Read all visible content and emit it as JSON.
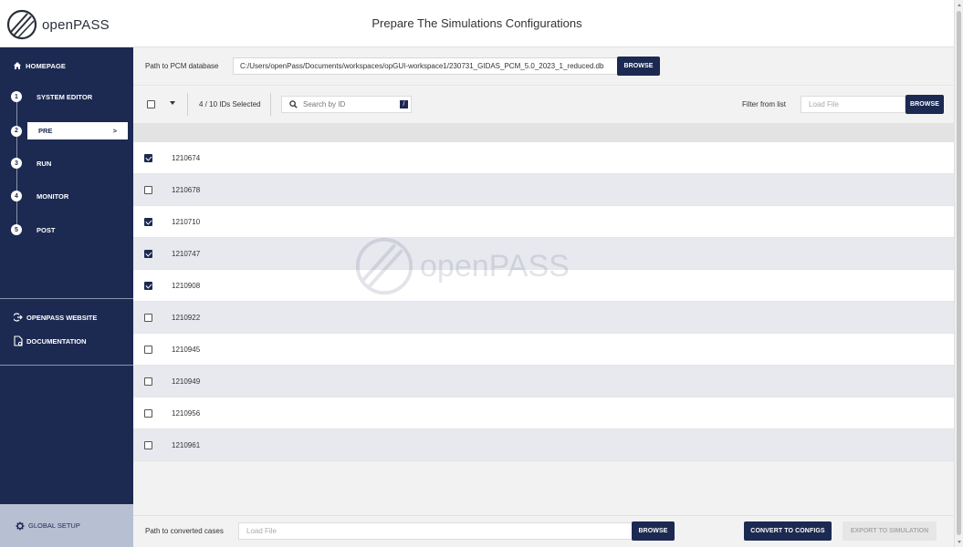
{
  "header": {
    "logo_text": "openPASS",
    "title": "Prepare The Simulations Configurations"
  },
  "sidebar": {
    "home": "HOMEPAGE",
    "steps": [
      {
        "num": "1",
        "label": "SYSTEM EDITOR"
      },
      {
        "num": "2",
        "label": "PRE",
        "chevron": ">"
      },
      {
        "num": "3",
        "label": "RUN"
      },
      {
        "num": "4",
        "label": "MONITOR"
      },
      {
        "num": "5",
        "label": "POST"
      }
    ],
    "links": [
      {
        "label": "OPENPASS WEBSITE"
      },
      {
        "label": "DOCUMENTATION"
      }
    ],
    "global_setup": "GLOBAL SETUP"
  },
  "path_row": {
    "label": "Path to PCM database",
    "value": "C:/Users/openPass/Documents/workspaces/opGUI-workspace1/230731_GIDAS_PCM_5.0_2023_1_reduced.db",
    "browse": "BROWSE"
  },
  "toolbar": {
    "selected_count": "4 / 10 IDs Selected",
    "search_placeholder": "Search by ID",
    "search_shortcut": "/",
    "filter_label": "Filter from list",
    "filter_placeholder": "Load File",
    "filter_browse": "BROWSE"
  },
  "rows": [
    {
      "id": "1210674",
      "checked": true
    },
    {
      "id": "1210678",
      "checked": false
    },
    {
      "id": "1210710",
      "checked": true
    },
    {
      "id": "1210747",
      "checked": true
    },
    {
      "id": "1210908",
      "checked": true
    },
    {
      "id": "1210922",
      "checked": false
    },
    {
      "id": "1210945",
      "checked": false
    },
    {
      "id": "1210949",
      "checked": false
    },
    {
      "id": "1210956",
      "checked": false
    },
    {
      "id": "1210961",
      "checked": false
    }
  ],
  "watermark": "openPASS",
  "bottom": {
    "label": "Path to converted cases",
    "placeholder": "Load File",
    "browse": "BROWSE",
    "convert": "CONVERT TO CONFIGS",
    "export": "EXPORT TO SIMULATION"
  },
  "colors": {
    "navy": "#1c2a52",
    "row_alt": "#e8e9ef",
    "sidebar_footer": "#b7c0d3"
  }
}
